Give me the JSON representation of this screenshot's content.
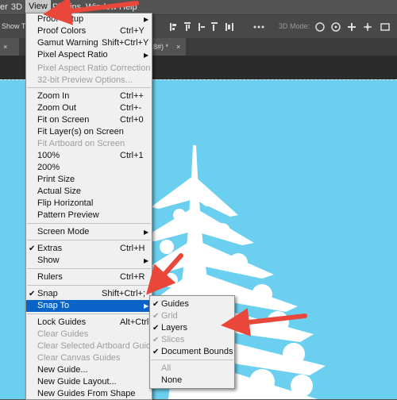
{
  "menubar": {
    "items": [
      "er",
      "3D",
      "View",
      "Plugins",
      "Window",
      "Help"
    ]
  },
  "optionsbar": {
    "left_text": "Show Tra",
    "mode3d": "3D Mode:"
  },
  "tabs": [
    {
      "label": "8#) *"
    }
  ],
  "view_menu": {
    "items": [
      {
        "label": "Proof Setup",
        "shortcut": "",
        "submenu": true,
        "enabled": true
      },
      {
        "label": "Proof Colors",
        "shortcut": "Ctrl+Y",
        "enabled": true
      },
      {
        "label": "Gamut Warning",
        "shortcut": "Shift+Ctrl+Y",
        "enabled": true
      },
      {
        "label": "Pixel Aspect Ratio",
        "shortcut": "",
        "submenu": true,
        "enabled": true
      },
      {
        "label": "Pixel Aspect Ratio Correction",
        "shortcut": "",
        "enabled": false
      },
      {
        "label": "32-bit Preview Options...",
        "shortcut": "",
        "enabled": false
      },
      {
        "label": "Zoom In",
        "shortcut": "Ctrl++",
        "enabled": true
      },
      {
        "label": "Zoom Out",
        "shortcut": "Ctrl+-",
        "enabled": true
      },
      {
        "label": "Fit on Screen",
        "shortcut": "Ctrl+0",
        "enabled": true
      },
      {
        "label": "Fit Layer(s) on Screen",
        "shortcut": "",
        "enabled": true
      },
      {
        "label": "Fit Artboard on Screen",
        "shortcut": "",
        "enabled": false
      },
      {
        "label": "100%",
        "shortcut": "Ctrl+1",
        "enabled": true
      },
      {
        "label": "200%",
        "shortcut": "",
        "enabled": true
      },
      {
        "label": "Print Size",
        "shortcut": "",
        "enabled": true
      },
      {
        "label": "Actual Size",
        "shortcut": "",
        "enabled": true
      },
      {
        "label": "Flip Horizontal",
        "shortcut": "",
        "enabled": true
      },
      {
        "label": "Pattern Preview",
        "shortcut": "",
        "enabled": true
      },
      {
        "label": "Screen Mode",
        "shortcut": "",
        "submenu": true,
        "enabled": true
      },
      {
        "label": "Extras",
        "shortcut": "Ctrl+H",
        "checked": true,
        "enabled": true
      },
      {
        "label": "Show",
        "shortcut": "",
        "submenu": true,
        "enabled": true
      },
      {
        "label": "Rulers",
        "shortcut": "Ctrl+R",
        "enabled": true
      },
      {
        "label": "Snap",
        "shortcut": "Shift+Ctrl+;",
        "checked": true,
        "enabled": true
      },
      {
        "label": "Snap To",
        "shortcut": "",
        "submenu": true,
        "highlighted": true,
        "enabled": true
      },
      {
        "label": "Lock Guides",
        "shortcut": "Alt+Ctrl+;",
        "enabled": true
      },
      {
        "label": "Clear Guides",
        "shortcut": "",
        "enabled": false
      },
      {
        "label": "Clear Selected Artboard Guides",
        "shortcut": "",
        "enabled": false
      },
      {
        "label": "Clear Canvas Guides",
        "shortcut": "",
        "enabled": false
      },
      {
        "label": "New Guide...",
        "shortcut": "",
        "enabled": true
      },
      {
        "label": "New Guide Layout...",
        "shortcut": "",
        "enabled": true
      },
      {
        "label": "New Guides From Shape",
        "shortcut": "",
        "enabled": true
      }
    ]
  },
  "snap_submenu": {
    "items": [
      {
        "label": "Guides",
        "checked": true,
        "enabled": true
      },
      {
        "label": "Grid",
        "checked": true,
        "enabled": false
      },
      {
        "label": "Layers",
        "checked": true,
        "enabled": true
      },
      {
        "label": "Slices",
        "checked": true,
        "enabled": false
      },
      {
        "label": "Document Bounds",
        "checked": true,
        "enabled": true
      },
      {
        "label": "All",
        "checked": false,
        "enabled": false
      },
      {
        "label": "None",
        "checked": false,
        "enabled": true
      }
    ]
  },
  "glyphs": {
    "check": "✔",
    "submenu_arrow": "▶",
    "close": "×"
  },
  "colors": {
    "canvas": "#6bd0ef",
    "highlight": "#0a64c8",
    "annotation_arrow": "#e8473a"
  }
}
